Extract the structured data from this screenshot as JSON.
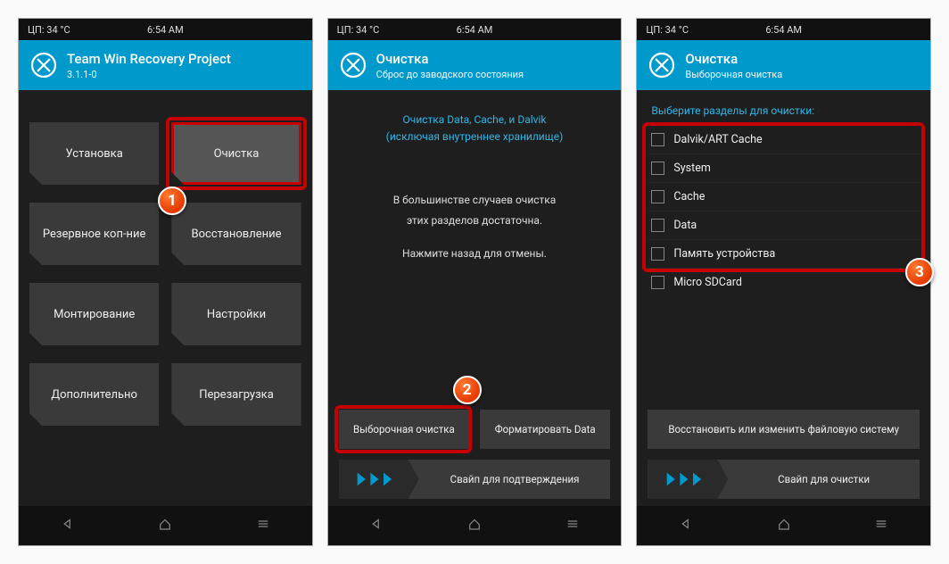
{
  "status": {
    "temp": "ЦП: 34 °C",
    "time": "6:54 AM"
  },
  "screen1": {
    "title": "Team Win Recovery Project",
    "version": "3.1.1-0",
    "tiles": {
      "install": "Установка",
      "wipe": "Очистка",
      "backup": "Резервное коп-ние",
      "restore": "Восстановление",
      "mount": "Монтирование",
      "settings": "Настройки",
      "advanced": "Дополнительно",
      "reboot": "Перезагрузка"
    }
  },
  "screen2": {
    "title": "Очистка",
    "subtitle": "Сброс до заводского состояния",
    "info1": "Очистка Data, Cache, и Dalvik",
    "info2": "(исключая внутреннее хранилище)",
    "mid1": "В большинстве случаев очистка",
    "mid2": "этих разделов достаточна.",
    "mid3": "Нажмите назад для отмены.",
    "btn_selective": "Выборочная очистка",
    "btn_format": "Форматировать Data",
    "swipe": "Свайп для подтверждения"
  },
  "screen3": {
    "title": "Очистка",
    "subtitle": "Выборочная очистка",
    "section": "Выберите разделы для очистки:",
    "items": {
      "dalvik": "Dalvik/ART Cache",
      "system": "System",
      "cache": "Cache",
      "data": "Data",
      "internal": "Память устройства",
      "sdcard": "Micro SDCard"
    },
    "btn_fs": "Восстановить или изменить файловую систему",
    "swipe": "Свайп для очистки"
  },
  "badges": {
    "b1": "1",
    "b2": "2",
    "b3": "3"
  }
}
